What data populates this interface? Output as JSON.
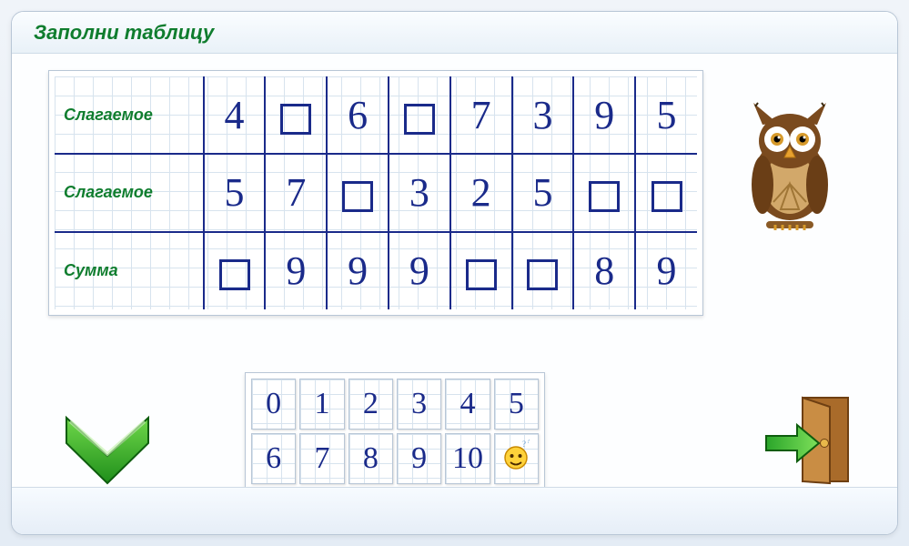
{
  "title": "Заполни таблицу",
  "rows": [
    {
      "label": "Слагаемое",
      "cells": [
        {
          "v": "4",
          "blank": false
        },
        {
          "v": "",
          "blank": true
        },
        {
          "v": "6",
          "blank": false
        },
        {
          "v": "",
          "blank": true
        },
        {
          "v": "7",
          "blank": false
        },
        {
          "v": "3",
          "blank": false
        },
        {
          "v": "9",
          "blank": false
        },
        {
          "v": "5",
          "blank": false
        }
      ]
    },
    {
      "label": "Слагаемое",
      "cells": [
        {
          "v": "5",
          "blank": false
        },
        {
          "v": "7",
          "blank": false
        },
        {
          "v": "",
          "blank": true
        },
        {
          "v": "3",
          "blank": false
        },
        {
          "v": "2",
          "blank": false
        },
        {
          "v": "5",
          "blank": false
        },
        {
          "v": "",
          "blank": true
        },
        {
          "v": "",
          "blank": true
        }
      ]
    },
    {
      "label": "Сумма",
      "cells": [
        {
          "v": "",
          "blank": true
        },
        {
          "v": "9",
          "blank": false
        },
        {
          "v": "9",
          "blank": false
        },
        {
          "v": "9",
          "blank": false
        },
        {
          "v": "",
          "blank": true
        },
        {
          "v": "",
          "blank": true
        },
        {
          "v": "8",
          "blank": false
        },
        {
          "v": "9",
          "blank": false
        }
      ]
    }
  ],
  "palette": [
    "0",
    "1",
    "2",
    "3",
    "4",
    "5",
    "6",
    "7",
    "8",
    "9",
    "10",
    "hint"
  ],
  "icons": {
    "check": "check-arrow-icon",
    "owl": "owl-mascot-icon",
    "exit": "exit-door-icon",
    "hint": "hint-smiley-icon"
  }
}
